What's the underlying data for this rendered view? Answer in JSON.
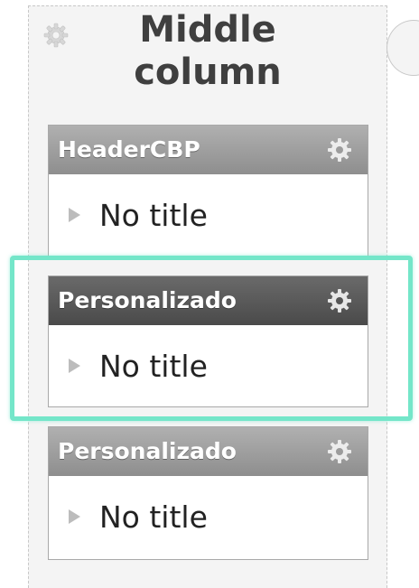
{
  "column": {
    "title": "Middle column",
    "settings_icon": "gear-icon"
  },
  "widgets": [
    {
      "header": "HeaderCBP",
      "item_title": "No title",
      "selected": false
    },
    {
      "header": "Personalizado",
      "item_title": "No title",
      "selected": true
    },
    {
      "header": "Personalizado",
      "item_title": "No title",
      "selected": false
    }
  ],
  "colors": {
    "header_light": "#9c9c9c",
    "header_dark": "#555555",
    "selection_outline": "#74e6c9",
    "arrow": "#bcbcbc"
  }
}
